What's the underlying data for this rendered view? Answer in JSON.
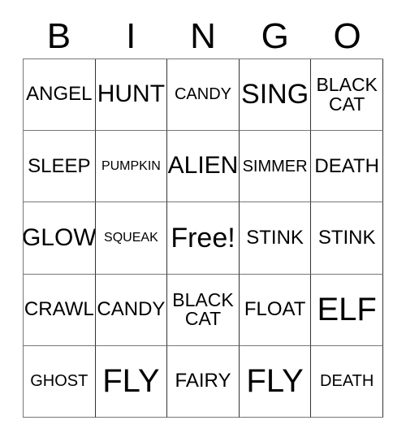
{
  "card": {
    "title_letters": [
      "B",
      "I",
      "N",
      "G",
      "O"
    ],
    "free_space_label": "Free!",
    "grid": {
      "rows": 5,
      "columns": 5,
      "cells": [
        [
          {
            "text": "ANGEL",
            "size": "sm"
          },
          {
            "text": "HUNT",
            "size": "md"
          },
          {
            "text": "CANDY",
            "size": "xs"
          },
          {
            "text": "SING",
            "size": "lg"
          },
          {
            "text": "BLACK\nCAT",
            "size": "two"
          }
        ],
        [
          {
            "text": "SLEEP",
            "size": "sm"
          },
          {
            "text": "PUMPKIN",
            "size": "xxs"
          },
          {
            "text": "ALIEN",
            "size": "md"
          },
          {
            "text": "SIMMER",
            "size": "xs"
          },
          {
            "text": "DEATH",
            "size": "sm"
          }
        ],
        [
          {
            "text": "GLOW",
            "size": "md"
          },
          {
            "text": "SQUEAK",
            "size": "xxs"
          },
          {
            "text": "Free!",
            "size": "lg"
          },
          {
            "text": "STINK",
            "size": "sm"
          },
          {
            "text": "STINK",
            "size": "sm"
          }
        ],
        [
          {
            "text": "CRAWL",
            "size": "sm"
          },
          {
            "text": "CANDY",
            "size": "sm"
          },
          {
            "text": "BLACK\nCAT",
            "size": "two"
          },
          {
            "text": "FLOAT",
            "size": "sm"
          },
          {
            "text": "ELF",
            "size": "xl"
          }
        ],
        [
          {
            "text": "GHOST",
            "size": "xs"
          },
          {
            "text": "FLY",
            "size": "xl"
          },
          {
            "text": "FAIRY",
            "size": "sm"
          },
          {
            "text": "FLY",
            "size": "xl"
          },
          {
            "text": "DEATH",
            "size": "xs"
          }
        ]
      ]
    },
    "colors": {
      "background": "#ffffff",
      "text": "#000000",
      "grid_line": "#777777",
      "grid_line_dark": "#333333"
    }
  }
}
